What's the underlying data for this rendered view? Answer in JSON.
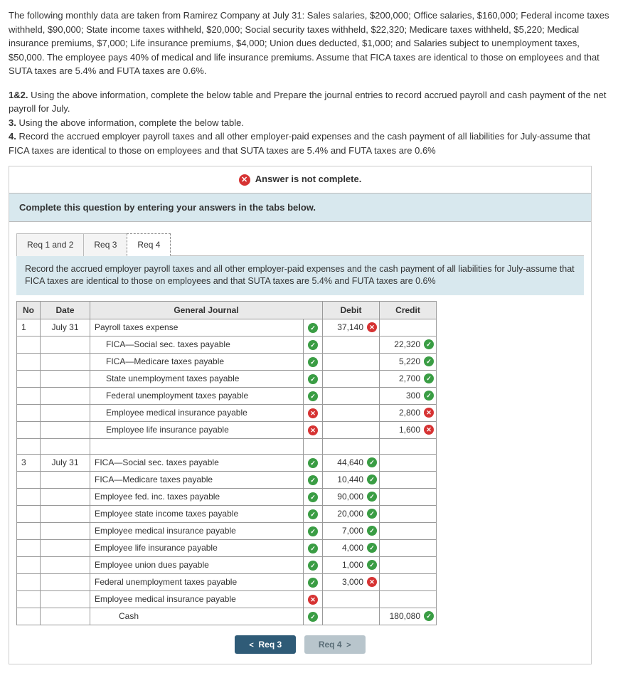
{
  "intro": "The following monthly data are taken from Ramirez Company at July 31: Sales salaries, $200,000; Office salaries, $160,000; Federal income taxes withheld, $90,000; State income taxes withheld, $20,000; Social security taxes withheld, $22,320; Medicare taxes withheld, $5,220; Medical insurance premiums, $7,000; Life insurance premiums, $4,000; Union dues deducted, $1,000; and Salaries subject to unemployment taxes, $50,000. The employee pays 40% of medical and life insurance premiums. Assume that FICA taxes are identical to those on employees and that SUTA taxes are 5.4% and FUTA taxes are 0.6%.",
  "tasks": {
    "t12_label": "1&2.",
    "t12_text": " Using the above information, complete the below table and Prepare the journal entries to record accrued payroll and cash payment of the net payroll for July.",
    "t3_label": "3.",
    "t3_text": " Using the above information, complete the below table.",
    "t4_label": "4.",
    "t4_text": " Record the accrued employer payroll taxes and all other employer-paid expenses and the cash payment of all liabilities for July-assume that FICA taxes are identical to those on employees and that SUTA taxes are 5.4% and FUTA taxes are 0.6%"
  },
  "status": "Answer is not complete.",
  "instruction_bar": "Complete this question by entering your answers in the tabs below.",
  "tabs": {
    "t1": "Req 1 and 2",
    "t2": "Req 3",
    "t3": "Req 4"
  },
  "sub_instruction": "Record the accrued employer payroll taxes and all other employer-paid expenses and the cash payment of all liabilities for July-assume that FICA taxes are identical to those on employees and that SUTA taxes are 5.4% and FUTA taxes are 0.6%",
  "headers": {
    "no": "No",
    "date": "Date",
    "gj": "General Journal",
    "debit": "Debit",
    "credit": "Credit"
  },
  "rows": [
    {
      "no": "1",
      "date": "July 31",
      "acct": "Payroll taxes expense",
      "mark": "ok",
      "debit": "37,140",
      "debit_mark": "bad",
      "credit": "",
      "indent": 0
    },
    {
      "acct": "FICA—Social sec. taxes payable",
      "mark": "ok",
      "credit": "22,320",
      "credit_mark": "ok",
      "indent": 1
    },
    {
      "acct": "FICA—Medicare taxes payable",
      "mark": "ok",
      "credit": "5,220",
      "credit_mark": "ok",
      "indent": 1
    },
    {
      "acct": "State unemployment taxes payable",
      "mark": "ok",
      "credit": "2,700",
      "credit_mark": "ok",
      "indent": 1
    },
    {
      "acct": "Federal unemployment taxes payable",
      "mark": "ok",
      "credit": "300",
      "credit_mark": "ok",
      "indent": 1
    },
    {
      "acct": "Employee medical insurance payable",
      "mark": "bad",
      "credit": "2,800",
      "credit_mark": "bad",
      "indent": 1
    },
    {
      "acct": "Employee life insurance payable",
      "mark": "bad",
      "credit": "1,600",
      "credit_mark": "bad",
      "indent": 1
    },
    {
      "blank": true
    },
    {
      "no": "3",
      "date": "July 31",
      "acct": "FICA—Social sec. taxes payable",
      "mark": "ok",
      "debit": "44,640",
      "debit_mark": "ok",
      "indent": 0
    },
    {
      "acct": "FICA—Medicare taxes payable",
      "mark": "ok",
      "debit": "10,440",
      "debit_mark": "ok",
      "indent": 0
    },
    {
      "acct": "Employee fed. inc. taxes payable",
      "mark": "ok",
      "debit": "90,000",
      "debit_mark": "ok",
      "indent": 0
    },
    {
      "acct": "Employee state income taxes payable",
      "mark": "ok",
      "debit": "20,000",
      "debit_mark": "ok",
      "indent": 0
    },
    {
      "acct": "Employee medical insurance payable",
      "mark": "ok",
      "debit": "7,000",
      "debit_mark": "ok",
      "indent": 0
    },
    {
      "acct": "Employee life insurance payable",
      "mark": "ok",
      "debit": "4,000",
      "debit_mark": "ok",
      "indent": 0
    },
    {
      "acct": "Employee union dues payable",
      "mark": "ok",
      "debit": "1,000",
      "debit_mark": "ok",
      "indent": 0
    },
    {
      "acct": "Federal unemployment taxes payable",
      "mark": "ok",
      "debit": "3,000",
      "debit_mark": "bad",
      "indent": 0
    },
    {
      "acct": "Employee medical insurance payable",
      "mark": "bad",
      "indent": 0
    },
    {
      "acct": "Cash",
      "mark": "ok",
      "credit": "180,080",
      "credit_mark": "ok",
      "indent": 2
    }
  ],
  "nav": {
    "prev": "Req 3",
    "next": "Req 4"
  }
}
